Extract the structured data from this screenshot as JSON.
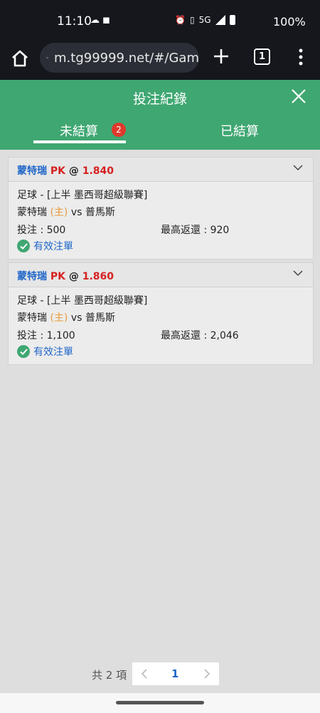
{
  "status_bar": {
    "time": "11:10",
    "battery": "100%",
    "network": "5G"
  },
  "browser": {
    "url": "m.tg99999.net/#/Gam",
    "tab_count": "1"
  },
  "header": {
    "title": "投注紀錄"
  },
  "tabs": [
    {
      "label": "未結算",
      "badge": "2",
      "active": true
    },
    {
      "label": "已結算",
      "active": false
    }
  ],
  "bets": [
    {
      "team": "蒙特瑞",
      "bet_type": "PK",
      "at": "@",
      "odds": "1.840",
      "match": "足球 - [上半 墨西哥超級聯賽]",
      "home": "蒙特瑞",
      "home_tag": "(主)",
      "vs": "vs",
      "away": "普馬斯",
      "stake": "投注 : 500",
      "max_payout": "最高返還 : 920",
      "status": "有效注單"
    },
    {
      "team": "蒙特瑞",
      "bet_type": "PK",
      "at": "@",
      "odds": "1.860",
      "match": "足球 - [上半 墨西哥超級聯賽]",
      "home": "蒙特瑞",
      "home_tag": "(主)",
      "vs": "vs",
      "away": "普馬斯",
      "stake": "投注 : 1,100",
      "max_payout": "最高返還 : 2,046",
      "status": "有效注單"
    }
  ],
  "pagination": {
    "total": "共 2 項",
    "current": "1"
  },
  "colors": {
    "green": "#3fa772",
    "blue": "#1f66c8",
    "red": "#d62020",
    "orange": "#e89a3a"
  }
}
